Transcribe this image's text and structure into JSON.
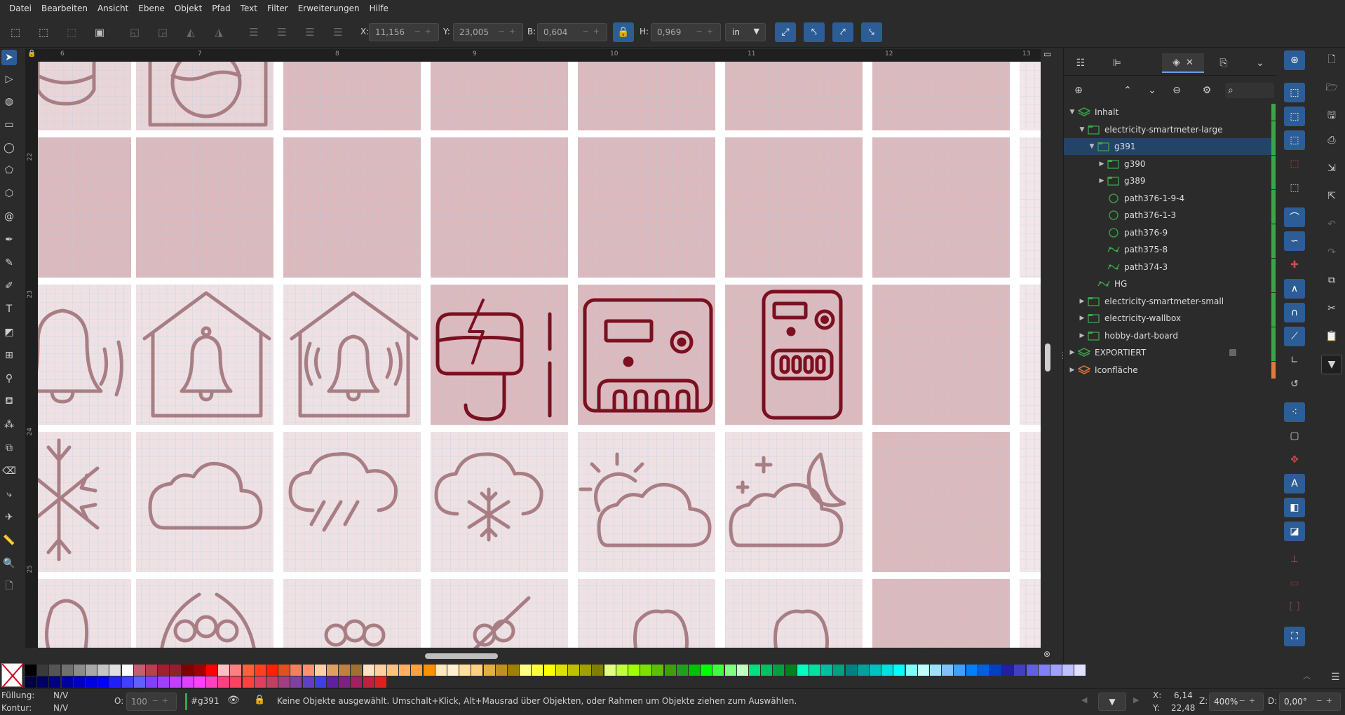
{
  "menu": [
    "Datei",
    "Bearbeiten",
    "Ansicht",
    "Ebene",
    "Objekt",
    "Pfad",
    "Text",
    "Filter",
    "Erweiterungen",
    "Hilfe"
  ],
  "toolbar": {
    "x_label": "X:",
    "x_value": "11,156",
    "y_label": "Y:",
    "y_value": "23,005",
    "w_label": "B:",
    "w_value": "0,604",
    "h_label": "H:",
    "h_value": "0,969",
    "unit": "in"
  },
  "ruler": {
    "top_labels": [
      "6",
      "7",
      "8",
      "9",
      "10",
      "11",
      "12",
      "13"
    ],
    "left_labels": [
      "22",
      "23",
      "24",
      "25"
    ]
  },
  "panel": {
    "tree": [
      {
        "label": "Inhalt",
        "level": 0,
        "kind": "layer",
        "caret": "down"
      },
      {
        "label": "electricity-smartmeter-large",
        "level": 1,
        "kind": "group",
        "caret": "down"
      },
      {
        "label": "g391",
        "level": 2,
        "kind": "group",
        "caret": "down",
        "selected": true
      },
      {
        "label": "g390",
        "level": 3,
        "kind": "group",
        "caret": "right"
      },
      {
        "label": "g389",
        "level": 3,
        "kind": "group",
        "caret": "right"
      },
      {
        "label": "path376-1-9-4",
        "level": 3,
        "kind": "circle",
        "caret": ""
      },
      {
        "label": "path376-1-3",
        "level": 3,
        "kind": "circle",
        "caret": ""
      },
      {
        "label": "path376-9",
        "level": 3,
        "kind": "circle",
        "caret": ""
      },
      {
        "label": "path375-8",
        "level": 3,
        "kind": "path",
        "caret": ""
      },
      {
        "label": "path374-3",
        "level": 3,
        "kind": "path",
        "caret": ""
      },
      {
        "label": "HG",
        "level": 2,
        "kind": "path",
        "caret": ""
      },
      {
        "label": "electricity-smartmeter-small",
        "level": 1,
        "kind": "group",
        "caret": "right"
      },
      {
        "label": "electricity-wallbox",
        "level": 1,
        "kind": "group",
        "caret": "right"
      },
      {
        "label": "hobby-dart-board",
        "level": 1,
        "kind": "group",
        "caret": "right"
      },
      {
        "label": "EXPORTIERT",
        "level": 0,
        "kind": "layer",
        "caret": "right"
      },
      {
        "label": "Iconfläche",
        "level": 0,
        "kind": "layer-orange",
        "caret": "right"
      }
    ]
  },
  "status": {
    "fill_label": "Füllung:",
    "fill_value": "N/V",
    "stroke_label": "Kontur:",
    "stroke_value": "N/V",
    "opacity_label": "O:",
    "opacity_value": "100",
    "object_id": "#g391",
    "message": "Keine Objekte ausgewählt. Umschalt+Klick, Alt+Mausrad über Objekten, oder Rahmen um Objekte ziehen zum Auswählen.",
    "cursor_x_label": "X:",
    "cursor_x": "6,14",
    "cursor_y_label": "Y:",
    "cursor_y": "22,48",
    "zoom_label": "Z:",
    "zoom": "400%",
    "rotation_label": "D:",
    "rotation": "0,00°"
  },
  "colors": {
    "accent": "#2d5d96",
    "icon_faded": "#a87e84",
    "icon_dark": "#7a1020",
    "tile_pink": "#e8c8cc",
    "tile_dark": "#dfbcc0",
    "grid_line": "#9fd0ef"
  }
}
